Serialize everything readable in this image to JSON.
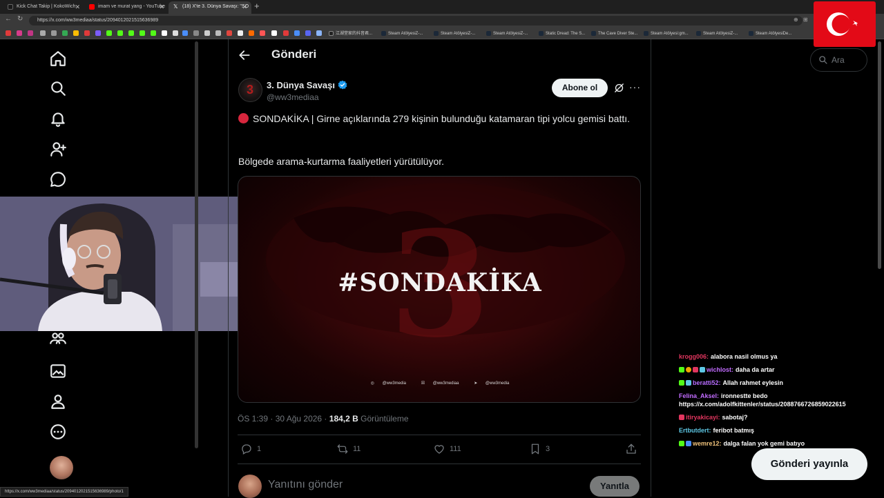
{
  "browser": {
    "tabs": [
      {
        "title": "Kick Chat Takip | KokoWich",
        "active": false
      },
      {
        "title": "imam ve murat yang - YouTube",
        "active": false
      },
      {
        "title": "(18) X'te 3. Dünya Savaşı: \"SO",
        "active": true
      }
    ],
    "url": "https://x.com/ww3mediaa/status/2094012021515636989",
    "bookmarks": [
      "江湖堂家的抖音君...",
      "Steam AtölyesiZ-...",
      "Steam AtölyesiZ-...",
      "Steam AtölyesiZ-...",
      "Static Dread: The S...",
      "The Cave Diver Ste...",
      "Steam Atölyesi:gm...",
      "Steam AtölyesiZ-...",
      "Steam AtölyesiDe..."
    ],
    "status_url": "https://x.com/ww3mediaa/status/2094012021515636989/photo/1"
  },
  "header": {
    "title": "Gönderi"
  },
  "post": {
    "display_name": "3. Dünya Savaşı",
    "handle": "@ww3mediaa",
    "subscribe_label": "Abone ol",
    "text_line1": "SONDAKİKA | Girne açıklarında 279 kişinin bulunduğu katamaran tipi yolcu gemisi battı.",
    "text_line2": "Bölgede arama-kurtarma faaliyetleri yürütülüyor.",
    "media": {
      "headline": "#SONDAKİKA",
      "socials": [
        "@ww3media",
        "@ww3mediaa",
        "@ww3media"
      ]
    },
    "timestamp": "ÖS 1:39 · 30 Ağu 2026",
    "views_count": "184,2 B",
    "views_label": "Görüntüleme",
    "replies": "1",
    "reposts": "11",
    "likes": "111",
    "bookmarks": "3"
  },
  "reply": {
    "placeholder": "Yanıtını gönder",
    "button": "Yanıtla"
  },
  "search": {
    "placeholder": "Ara"
  },
  "compose_label": "Gönderi yayınla",
  "chat": [
    {
      "user": "krogg006:",
      "msg": "alabora nasil olmus ya",
      "color": "#e2365f"
    },
    {
      "user": "wichlost:",
      "msg": "daha da artar",
      "color": "#c26cff"
    },
    {
      "user": "beratti52:",
      "msg": "Allah rahmet eylesin",
      "color": "#b76cff"
    },
    {
      "user": "Felina_Aksel:",
      "msg": "ironnestte bedo https://x.com/adolfkittenler/status/2088766726859022615",
      "color": "#c26cff"
    },
    {
      "user": "itiryakicayi:",
      "msg": "sabotaj?",
      "color": "#e2365f"
    },
    {
      "user": "Ertbutdert:",
      "msg": "feribot batmış",
      "color": "#5ec8e5"
    },
    {
      "user": "wemre12:",
      "msg": "dalga falan yok gemi batıyo",
      "color": "#f0c27b"
    }
  ],
  "colors": {
    "accent": "#1d9bf0",
    "flag": "#e30a17",
    "media_red": "#5a0d10"
  }
}
